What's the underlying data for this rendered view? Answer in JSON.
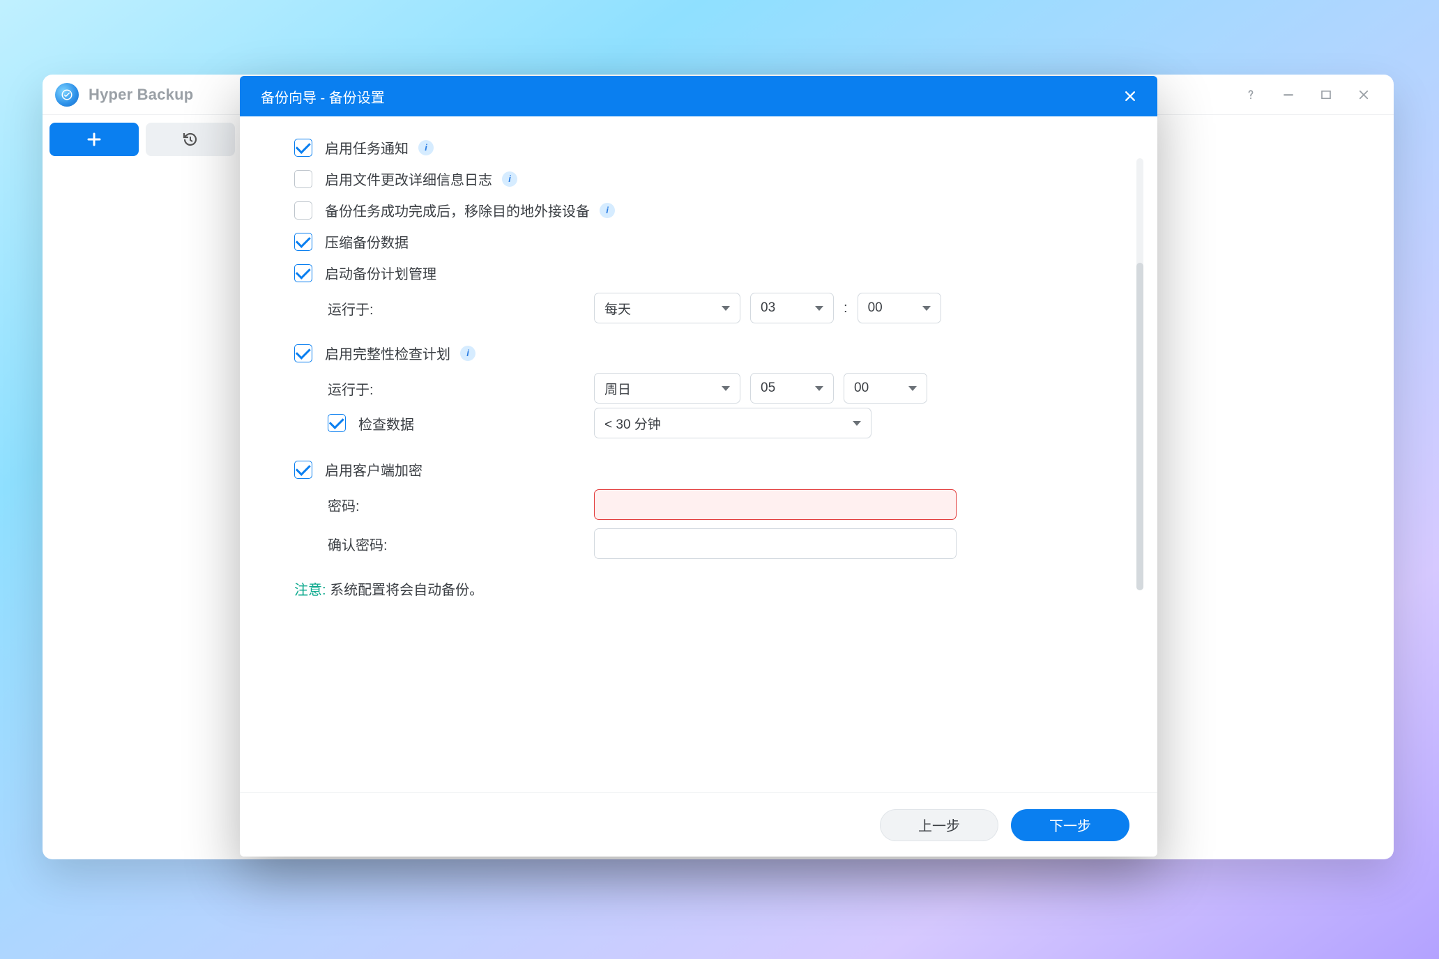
{
  "app": {
    "title": "Hyper Backup"
  },
  "wizard": {
    "title": "备份向导 - 备份设置"
  },
  "options": {
    "enable_task_notification": "启用任务通知",
    "enable_file_change_log": "启用文件更改详细信息日志",
    "remove_external_after_success": "备份任务成功完成后，移除目的地外接设备",
    "compress_backup_data": "压缩备份数据",
    "enable_backup_schedule": "启动备份计划管理",
    "enable_integrity_check": "启用完整性检查计划",
    "check_data": "检查数据",
    "enable_client_encryption": "启用客户端加密"
  },
  "labels": {
    "run_at": "运行于:",
    "password": "密码:",
    "confirm_password": "确认密码:"
  },
  "schedule_backup": {
    "freq": "每天",
    "hour": "03",
    "minute": "00"
  },
  "schedule_integrity": {
    "freq": "周日",
    "hour": "05",
    "minute": "00",
    "duration": "< 30 分钟"
  },
  "encryption": {
    "password": "",
    "confirm": ""
  },
  "note": {
    "label": "注意:",
    "text": " 系统配置将会自动备份。"
  },
  "buttons": {
    "prev": "上一步",
    "next": "下一步"
  }
}
